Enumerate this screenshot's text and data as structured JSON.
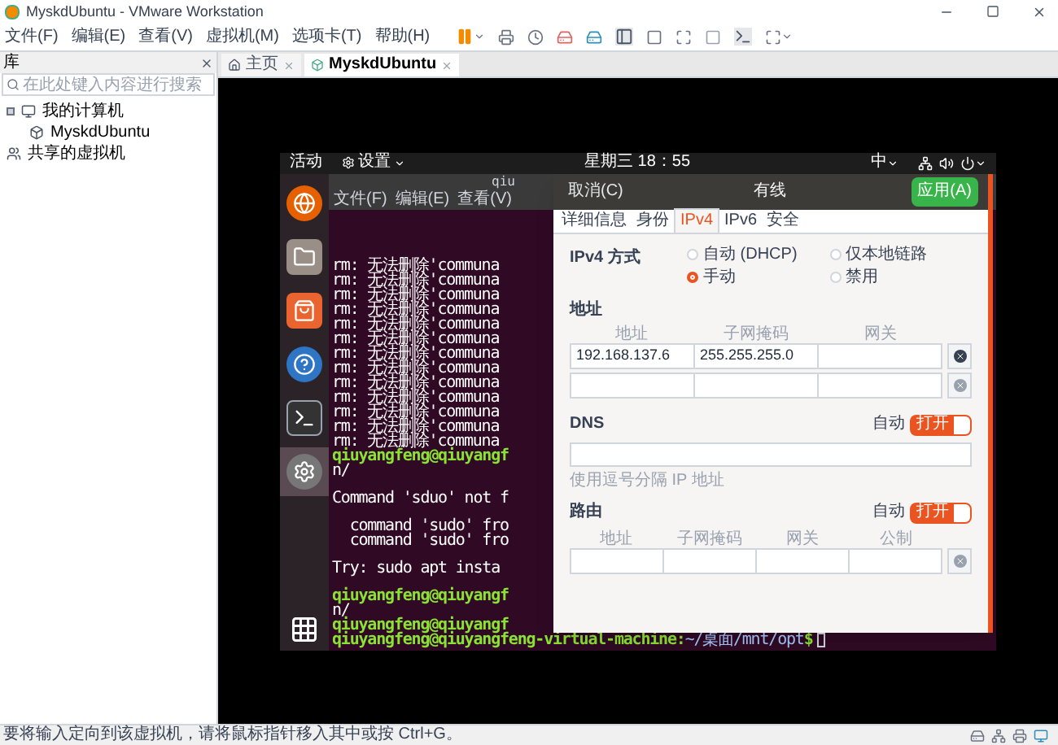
{
  "window": {
    "title": "MyskdUbuntu - VMware Workstation"
  },
  "menu": [
    "文件(F)",
    "编辑(E)",
    "查看(V)",
    "虚拟机(M)",
    "选项卡(T)",
    "帮助(H)"
  ],
  "library": {
    "title": "库",
    "search": {
      "placeholder": "在此处键入内容进行搜索"
    },
    "tree": [
      {
        "label": "我的计算机",
        "kind": "computer",
        "expanded": true,
        "children": [
          {
            "label": "MyskdUbuntu",
            "kind": "vm"
          }
        ]
      },
      {
        "label": "共享的虚拟机",
        "kind": "shared"
      }
    ]
  },
  "tabs": [
    {
      "label": "主页",
      "kind": "home",
      "selected": false
    },
    {
      "label": "MyskdUbuntu",
      "kind": "vm",
      "selected": true
    }
  ],
  "ubuntu": {
    "activities": "活动",
    "app_menu": "设置",
    "clock": "星期三 18：55",
    "input_method": "中",
    "dock": [
      {
        "kind": "browser",
        "selected": false
      },
      {
        "kind": "files",
        "selected": false
      },
      {
        "kind": "store",
        "selected": false
      },
      {
        "kind": "help",
        "selected": false
      },
      {
        "kind": "terminal",
        "selected": false
      },
      {
        "kind": "settings",
        "selected": true
      }
    ],
    "terminal": {
      "title": "qiu",
      "menu": [
        "文件(F)",
        "编辑(E)",
        "查看(V)"
      ],
      "lines": [
        {
          "kind": "output",
          "text": "rm: 无法删除'communa"
        },
        {
          "kind": "output",
          "text": "rm: 无法删除'communa"
        },
        {
          "kind": "output",
          "text": "rm: 无法删除'communa"
        },
        {
          "kind": "output",
          "text": "rm: 无法删除'communa"
        },
        {
          "kind": "output",
          "text": "rm: 无法删除'communa"
        },
        {
          "kind": "output",
          "text": "rm: 无法删除'communa"
        },
        {
          "kind": "output",
          "text": "rm: 无法删除'communa"
        },
        {
          "kind": "output",
          "text": "rm: 无法删除'communa"
        },
        {
          "kind": "output",
          "text": "rm: 无法删除'communa"
        },
        {
          "kind": "output",
          "text": "rm: 无法删除'communa"
        },
        {
          "kind": "output",
          "text": "rm: 无法删除'communa"
        },
        {
          "kind": "output",
          "text": "rm: 无法删除'communa"
        },
        {
          "kind": "output",
          "text": "rm: 无法删除'communa"
        },
        {
          "kind": "prompt",
          "text": "qiuyangfeng@qiuyangf"
        },
        {
          "kind": "output",
          "text": "n/"
        },
        {
          "kind": "blank"
        },
        {
          "kind": "output",
          "text": "Command 'sduo' not f"
        },
        {
          "kind": "blank"
        },
        {
          "kind": "output",
          "text": "  command 'sudo' fro"
        },
        {
          "kind": "output",
          "text": "  command 'sudo' fro"
        },
        {
          "kind": "blank"
        },
        {
          "kind": "output",
          "text": "Try: sudo apt insta"
        },
        {
          "kind": "blank"
        },
        {
          "kind": "prompt",
          "text": "qiuyangfeng@qiuyangf"
        },
        {
          "kind": "output",
          "text": "n/"
        },
        {
          "kind": "prompt",
          "text": "qiuyangfeng@qiuyangf"
        }
      ],
      "prompt": {
        "user_host": "qiuyangfeng@qiuyangfeng-virtual-machine:",
        "path": "~/桌面/mnt/opt",
        "symbol": "$"
      }
    },
    "dialog": {
      "cancel": "取消(C)",
      "title": "有线",
      "apply": "应用(A)",
      "tabs": [
        {
          "label": "详细信息",
          "selected": false
        },
        {
          "label": "身份",
          "selected": false
        },
        {
          "label": "IPv4",
          "selected": true
        },
        {
          "label": "IPv6",
          "selected": false
        },
        {
          "label": "安全",
          "selected": false
        }
      ],
      "method_label": "IPv4 方式",
      "methods": [
        {
          "label": "自动 (DHCP)",
          "selected": false
        },
        {
          "label": "仅本地链路",
          "selected": false
        },
        {
          "label": "手动",
          "selected": true
        },
        {
          "label": "禁用",
          "selected": false
        }
      ],
      "address": {
        "title": "地址",
        "columns": [
          "地址",
          "子网掩码",
          "网关"
        ],
        "rows": [
          [
            "192.168.137.6",
            "255.255.255.0",
            null
          ],
          [
            null,
            null,
            null
          ]
        ]
      },
      "dns": {
        "title": "DNS",
        "auto_label": "自动",
        "toggle_label": "打开",
        "on": true,
        "hint": "使用逗号分隔 IP 地址"
      },
      "routes": {
        "title": "路由",
        "auto_label": "自动",
        "toggle_label": "打开",
        "on": true,
        "columns": [
          "地址",
          "子网掩码",
          "网关",
          "公制"
        ],
        "rows": [
          [
            null,
            null,
            null,
            null
          ]
        ]
      }
    }
  },
  "status_bar": {
    "text": "要将输入定向到该虚拟机，请将鼠标指针移入其中或按 Ctrl+G。"
  }
}
